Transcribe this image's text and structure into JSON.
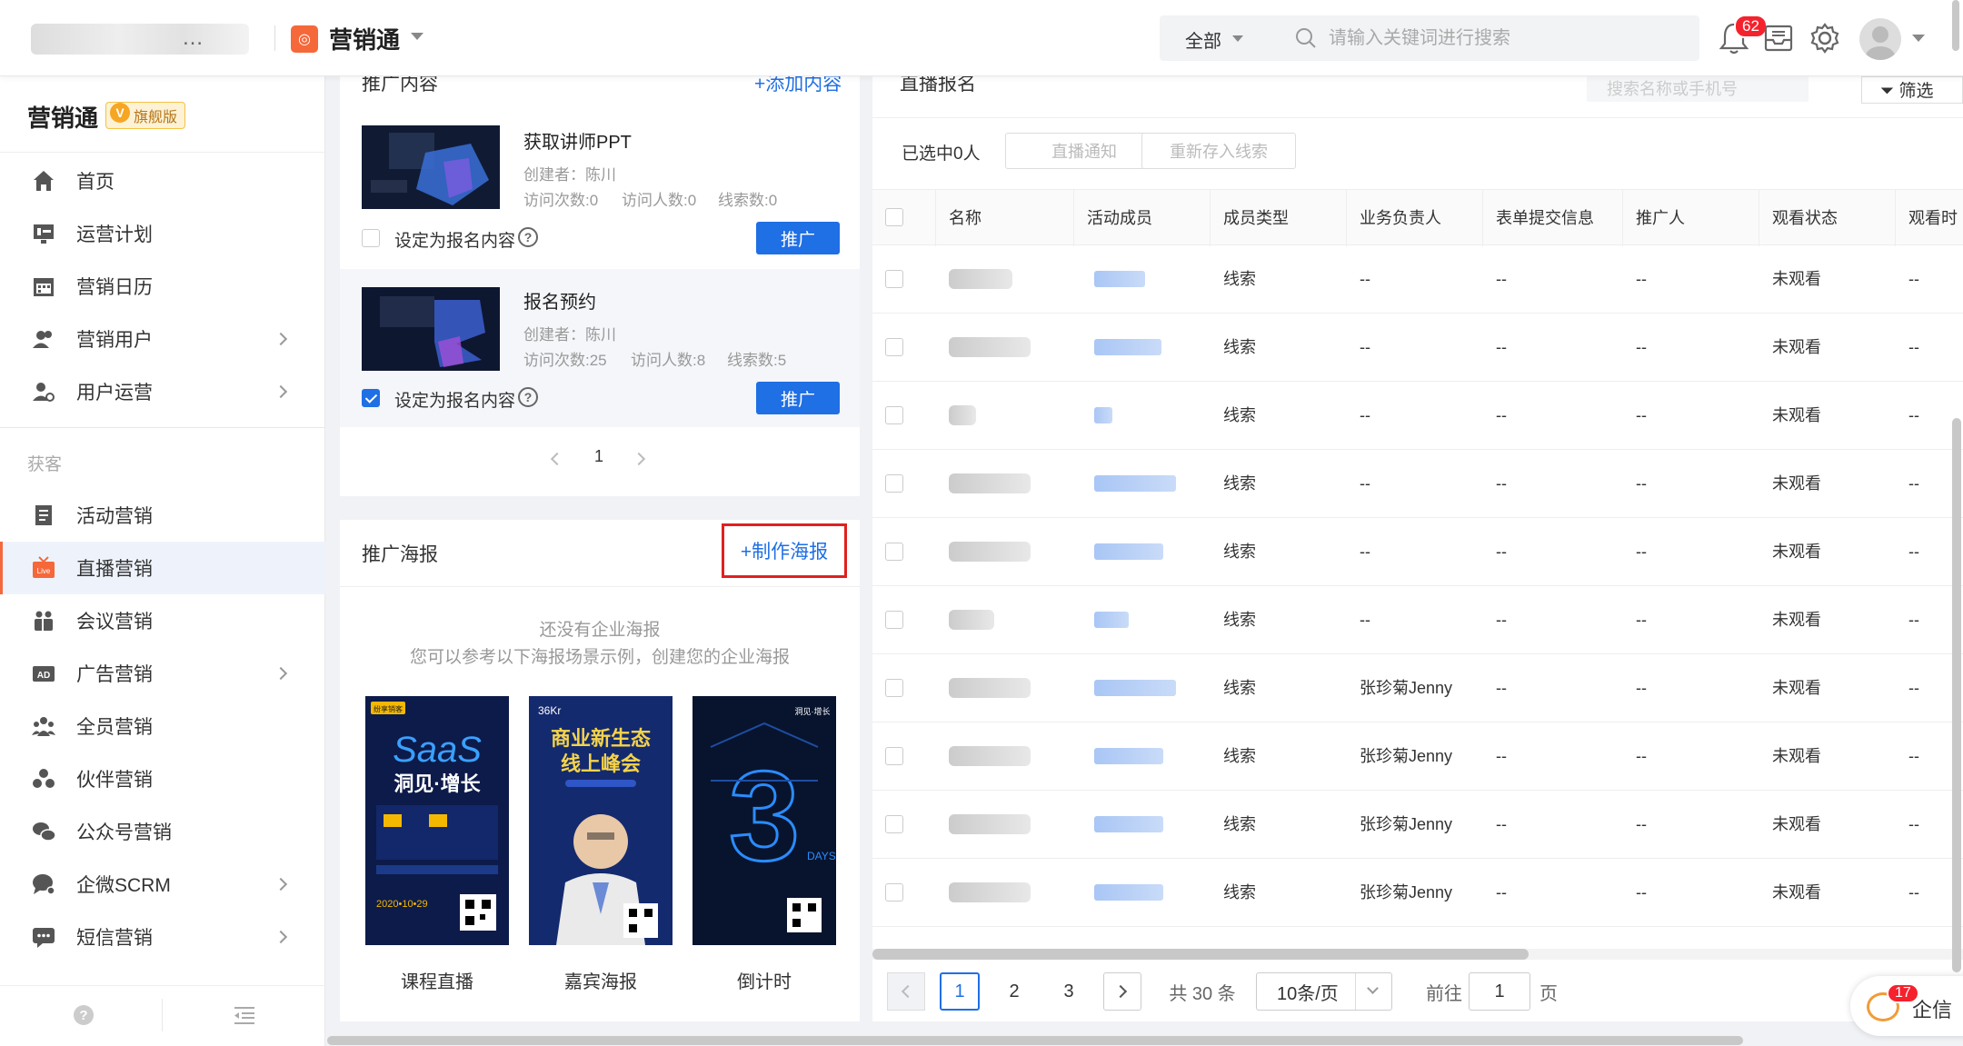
{
  "topbar": {
    "org_name_suffix": "…",
    "app_name": "营销通",
    "search_scope": "全部",
    "search_placeholder": "请输入关键词进行搜索",
    "notification_count": "62"
  },
  "sidebar": {
    "title": "营销通",
    "edition": "旗舰版",
    "items": [
      {
        "label": "首页",
        "icon": "home-icon"
      },
      {
        "label": "运营计划",
        "icon": "plan-icon"
      },
      {
        "label": "营销日历",
        "icon": "calendar-icon"
      },
      {
        "label": "营销用户",
        "icon": "users-icon"
      },
      {
        "label": "用户运营",
        "icon": "user-ops-icon"
      }
    ],
    "section": "获客",
    "acq_items": [
      {
        "label": "活动营销",
        "icon": "document-icon"
      },
      {
        "label": "直播营销",
        "icon": "live-icon"
      },
      {
        "label": "会议营销",
        "icon": "meeting-icon"
      },
      {
        "label": "广告营销",
        "icon": "ad-icon"
      },
      {
        "label": "全员营销",
        "icon": "team-icon"
      },
      {
        "label": "伙伴营销",
        "icon": "partner-icon"
      },
      {
        "label": "公众号营销",
        "icon": "wechat-icon"
      },
      {
        "label": "企微SCRM",
        "icon": "chat-icon"
      },
      {
        "label": "短信营销",
        "icon": "sms-icon"
      }
    ],
    "live_badge": "Live"
  },
  "promo": {
    "title": "推广内容",
    "add_link": "+添加内容",
    "cards": [
      {
        "title": "获取讲师PPT",
        "creator": "创建者：陈川",
        "visits": "访问次数:0",
        "visitors": "访问人数:0",
        "leads": "线索数:0",
        "checkbox_label": "设定为报名内容",
        "button": "推广",
        "checked": false
      },
      {
        "title": "报名预约",
        "creator": "创建者：陈川",
        "visits": "访问次数:25",
        "visitors": "访问人数:8",
        "leads": "线索数:5",
        "checkbox_label": "设定为报名内容",
        "button": "推广",
        "checked": true
      }
    ],
    "page": "1"
  },
  "posters": {
    "title": "推广海报",
    "make_link": "+制作海报",
    "empty_line1": "还没有企业海报",
    "empty_line2": "您可以参考以下海报场景示例，创建您的企业海报",
    "examples": [
      {
        "label": "课程直播",
        "brand": "纷享销客",
        "big": "SaaS",
        "title": "洞见·增长",
        "date": "2020•10•29"
      },
      {
        "label": "嘉宾海报",
        "brand": "36Kr",
        "big": "商业新生态",
        "title": "线上峰会",
        "date": ""
      },
      {
        "label": "倒计时",
        "brand": "洞见·增长",
        "big": "3",
        "title": "DAYS",
        "date": ""
      }
    ]
  },
  "live_signup": {
    "title": "直播报名",
    "search_placeholder": "搜索名称或手机号",
    "filter": "筛选",
    "selected": "已选中0人",
    "btn_notify": "直播通知",
    "btn_restore": "重新存入线索",
    "columns": [
      "名称",
      "活动成员",
      "成员类型",
      "业务负责人",
      "表单提交信息",
      "推广人",
      "观看状态",
      "观看时"
    ],
    "rows": [
      {
        "type": "线索",
        "owner": "--",
        "form": "--",
        "promoter": "--",
        "status": "未观看",
        "time": "--"
      },
      {
        "type": "线索",
        "owner": "--",
        "form": "--",
        "promoter": "--",
        "status": "未观看",
        "time": "--"
      },
      {
        "type": "线索",
        "owner": "--",
        "form": "--",
        "promoter": "--",
        "status": "未观看",
        "time": "--"
      },
      {
        "type": "线索",
        "owner": "--",
        "form": "--",
        "promoter": "--",
        "status": "未观看",
        "time": "--"
      },
      {
        "type": "线索",
        "owner": "--",
        "form": "--",
        "promoter": "--",
        "status": "未观看",
        "time": "--"
      },
      {
        "type": "线索",
        "owner": "--",
        "form": "--",
        "promoter": "--",
        "status": "未观看",
        "time": "--"
      },
      {
        "type": "线索",
        "owner": "张珍菊Jenny",
        "form": "--",
        "promoter": "--",
        "status": "未观看",
        "time": "--"
      },
      {
        "type": "线索",
        "owner": "张珍菊Jenny",
        "form": "--",
        "promoter": "--",
        "status": "未观看",
        "time": "--"
      },
      {
        "type": "线索",
        "owner": "张珍菊Jenny",
        "form": "--",
        "promoter": "--",
        "status": "未观看",
        "time": "--"
      },
      {
        "type": "线索",
        "owner": "张珍菊Jenny",
        "form": "--",
        "promoter": "--",
        "status": "未观看",
        "time": "--"
      }
    ],
    "pagination": {
      "pages": [
        "1",
        "2",
        "3"
      ],
      "total": "共 30 条",
      "page_size": "10条/页",
      "goto_label": "前往",
      "goto_value": "1",
      "goto_suffix": "页"
    }
  },
  "qixin": {
    "label": "企信",
    "badge": "17"
  },
  "colors": {
    "primary": "#1f6fe5",
    "accent": "#f5683a",
    "danger": "#f5222d",
    "highlight_box": "#e02020"
  }
}
